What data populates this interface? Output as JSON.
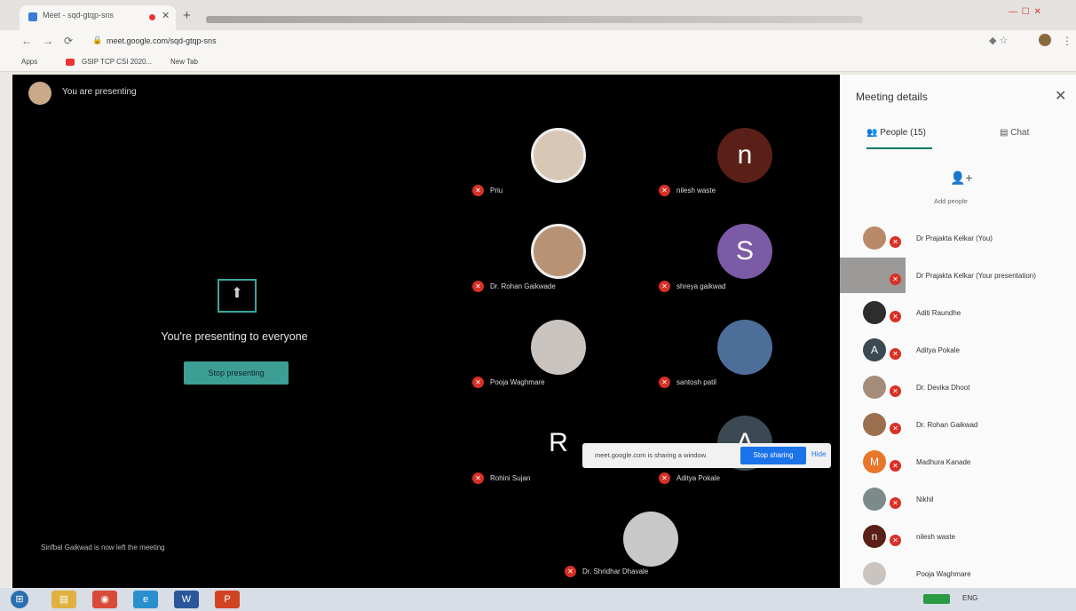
{
  "browser": {
    "tab_title": "Meet - sqd-gtqp-sns",
    "tab_close": "✕",
    "new_tab": "+",
    "window_controls": "—  ☐  ✕",
    "url": "meet.google.com/sqd-gtqp-sns",
    "bookmarks": [
      "Apps",
      "GSIP TCP CSI 2020...",
      "New Tab"
    ]
  },
  "stage": {
    "presenting_label": "You are presenting",
    "present_message": "You're presenting to everyone",
    "stop_presenting": "Stop presenting",
    "left_message": "Sinfbal Gaikwad is now left the meeting"
  },
  "tiles": [
    {
      "name": "Priu",
      "letter": "",
      "color": "#d9c7b6"
    },
    {
      "name": "nilesh waste",
      "letter": "n",
      "color": "#5a1f16"
    },
    {
      "name": "Dr. Rohan Gaikwade",
      "letter": "",
      "color": "#b89274"
    },
    {
      "name": "shreya gaikwad",
      "letter": "S",
      "color": "#7b5aa6"
    },
    {
      "name": "Pooja Waghmare",
      "letter": "",
      "color": "#c9c4c0"
    },
    {
      "name": "santosh patil",
      "letter": "",
      "color": "#4e6e9a"
    },
    {
      "name": "Rohini Sujan",
      "letter": "R",
      "color": "#000000"
    },
    {
      "name": "Aditya Pokale",
      "letter": "A",
      "color": "#3b4a52"
    },
    {
      "name": "Dr. Shridhar Dhavale",
      "letter": "",
      "color": "#c8c8c8"
    }
  ],
  "share_bar": {
    "text": "meet.google.com is sharing a window.",
    "stop": "Stop sharing",
    "hide": "Hide"
  },
  "panel": {
    "title": "Meeting details",
    "close": "✕",
    "people_tab": "People (15)",
    "chat_tab": "Chat",
    "add_people": "Add people",
    "people": [
      {
        "name": "Dr Prajakta Kelkar (You)",
        "letter": "",
        "color": "#b98a6a"
      },
      {
        "name": "Dr Prajakta Kelkar (Your presentation)",
        "letter": "",
        "color": "#8a8886"
      },
      {
        "name": "Aditi Raundhe",
        "letter": "",
        "color": "#2d2d2d"
      },
      {
        "name": "Aditya Pokale",
        "letter": "A",
        "color": "#3b4a52"
      },
      {
        "name": "Dr. Devika Dhoot",
        "letter": "",
        "color": "#a58b7a"
      },
      {
        "name": "Dr. Rohan Gaikwad",
        "letter": "",
        "color": "#9c6f4f"
      },
      {
        "name": "Madhura Kanade",
        "letter": "M",
        "color": "#e8762b"
      },
      {
        "name": "Nikhil",
        "letter": "",
        "color": "#7c8b8a"
      },
      {
        "name": "nilesh waste",
        "letter": "n",
        "color": "#5a1f16"
      },
      {
        "name": "Pooja Waghmare",
        "letter": "",
        "color": "#c9c4c0"
      }
    ]
  },
  "taskbar": [
    "⊞",
    "▤",
    "◉",
    "e",
    "W",
    "P"
  ],
  "tray": "ENG"
}
